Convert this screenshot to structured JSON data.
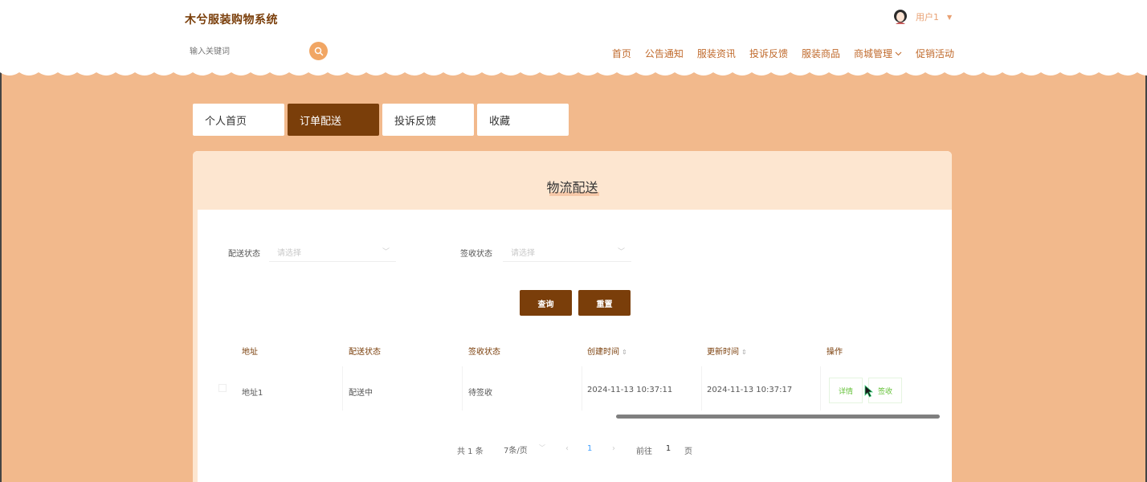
{
  "header": {
    "brand": "木兮服装购物系统",
    "search_placeholder": "输入关键词",
    "user_name": "用户1",
    "nav": [
      "首页",
      "公告通知",
      "服装资讯",
      "投诉反馈",
      "服装商品",
      "商城管理",
      "促销活动"
    ]
  },
  "tabs": [
    "个人首页",
    "订单配送",
    "投诉反馈",
    "收藏"
  ],
  "panel": {
    "title": "物流配送",
    "filters": [
      {
        "label": "配送状态",
        "placeholder": "请选择"
      },
      {
        "label": "签收状态",
        "placeholder": "请选择"
      }
    ],
    "buttons": {
      "query": "查询",
      "reset": "重置"
    }
  },
  "table": {
    "columns": [
      "地址",
      "配送状态",
      "签收状态",
      "创建时间",
      "更新时间",
      "操作"
    ],
    "rows": [
      {
        "address": "地址1",
        "delivery_status": "配送中",
        "sign_status": "待签收",
        "created": "2024-11-13 10:37:11",
        "updated": "2024-11-13 10:37:17"
      }
    ],
    "actions": {
      "detail": "详情",
      "sign": "签收"
    }
  },
  "pagination": {
    "total": "共 1 条",
    "page_size": "7条/页",
    "current_page": "1",
    "goto_label": "前往",
    "goto_value": "1",
    "page_suffix": "页"
  },
  "colors": {
    "brand": "#7a3e0a",
    "background": "#f2b98c",
    "panel_head": "#fde6d0",
    "accent_orange": "#f1a664"
  }
}
